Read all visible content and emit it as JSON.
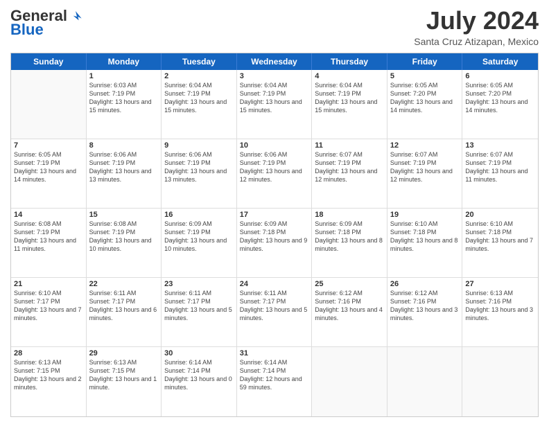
{
  "header": {
    "logo_general": "General",
    "logo_blue": "Blue",
    "month_year": "July 2024",
    "location": "Santa Cruz Atizapan, Mexico"
  },
  "calendar": {
    "days": [
      "Sunday",
      "Monday",
      "Tuesday",
      "Wednesday",
      "Thursday",
      "Friday",
      "Saturday"
    ],
    "rows": [
      [
        {
          "day": "",
          "sunrise": "",
          "sunset": "",
          "daylight": ""
        },
        {
          "day": "1",
          "sunrise": "Sunrise: 6:03 AM",
          "sunset": "Sunset: 7:19 PM",
          "daylight": "Daylight: 13 hours and 15 minutes."
        },
        {
          "day": "2",
          "sunrise": "Sunrise: 6:04 AM",
          "sunset": "Sunset: 7:19 PM",
          "daylight": "Daylight: 13 hours and 15 minutes."
        },
        {
          "day": "3",
          "sunrise": "Sunrise: 6:04 AM",
          "sunset": "Sunset: 7:19 PM",
          "daylight": "Daylight: 13 hours and 15 minutes."
        },
        {
          "day": "4",
          "sunrise": "Sunrise: 6:04 AM",
          "sunset": "Sunset: 7:19 PM",
          "daylight": "Daylight: 13 hours and 15 minutes."
        },
        {
          "day": "5",
          "sunrise": "Sunrise: 6:05 AM",
          "sunset": "Sunset: 7:20 PM",
          "daylight": "Daylight: 13 hours and 14 minutes."
        },
        {
          "day": "6",
          "sunrise": "Sunrise: 6:05 AM",
          "sunset": "Sunset: 7:20 PM",
          "daylight": "Daylight: 13 hours and 14 minutes."
        }
      ],
      [
        {
          "day": "7",
          "sunrise": "Sunrise: 6:05 AM",
          "sunset": "Sunset: 7:19 PM",
          "daylight": "Daylight: 13 hours and 14 minutes."
        },
        {
          "day": "8",
          "sunrise": "Sunrise: 6:06 AM",
          "sunset": "Sunset: 7:19 PM",
          "daylight": "Daylight: 13 hours and 13 minutes."
        },
        {
          "day": "9",
          "sunrise": "Sunrise: 6:06 AM",
          "sunset": "Sunset: 7:19 PM",
          "daylight": "Daylight: 13 hours and 13 minutes."
        },
        {
          "day": "10",
          "sunrise": "Sunrise: 6:06 AM",
          "sunset": "Sunset: 7:19 PM",
          "daylight": "Daylight: 13 hours and 12 minutes."
        },
        {
          "day": "11",
          "sunrise": "Sunrise: 6:07 AM",
          "sunset": "Sunset: 7:19 PM",
          "daylight": "Daylight: 13 hours and 12 minutes."
        },
        {
          "day": "12",
          "sunrise": "Sunrise: 6:07 AM",
          "sunset": "Sunset: 7:19 PM",
          "daylight": "Daylight: 13 hours and 12 minutes."
        },
        {
          "day": "13",
          "sunrise": "Sunrise: 6:07 AM",
          "sunset": "Sunset: 7:19 PM",
          "daylight": "Daylight: 13 hours and 11 minutes."
        }
      ],
      [
        {
          "day": "14",
          "sunrise": "Sunrise: 6:08 AM",
          "sunset": "Sunset: 7:19 PM",
          "daylight": "Daylight: 13 hours and 11 minutes."
        },
        {
          "day": "15",
          "sunrise": "Sunrise: 6:08 AM",
          "sunset": "Sunset: 7:19 PM",
          "daylight": "Daylight: 13 hours and 10 minutes."
        },
        {
          "day": "16",
          "sunrise": "Sunrise: 6:09 AM",
          "sunset": "Sunset: 7:19 PM",
          "daylight": "Daylight: 13 hours and 10 minutes."
        },
        {
          "day": "17",
          "sunrise": "Sunrise: 6:09 AM",
          "sunset": "Sunset: 7:18 PM",
          "daylight": "Daylight: 13 hours and 9 minutes."
        },
        {
          "day": "18",
          "sunrise": "Sunrise: 6:09 AM",
          "sunset": "Sunset: 7:18 PM",
          "daylight": "Daylight: 13 hours and 8 minutes."
        },
        {
          "day": "19",
          "sunrise": "Sunrise: 6:10 AM",
          "sunset": "Sunset: 7:18 PM",
          "daylight": "Daylight: 13 hours and 8 minutes."
        },
        {
          "day": "20",
          "sunrise": "Sunrise: 6:10 AM",
          "sunset": "Sunset: 7:18 PM",
          "daylight": "Daylight: 13 hours and 7 minutes."
        }
      ],
      [
        {
          "day": "21",
          "sunrise": "Sunrise: 6:10 AM",
          "sunset": "Sunset: 7:17 PM",
          "daylight": "Daylight: 13 hours and 7 minutes."
        },
        {
          "day": "22",
          "sunrise": "Sunrise: 6:11 AM",
          "sunset": "Sunset: 7:17 PM",
          "daylight": "Daylight: 13 hours and 6 minutes."
        },
        {
          "day": "23",
          "sunrise": "Sunrise: 6:11 AM",
          "sunset": "Sunset: 7:17 PM",
          "daylight": "Daylight: 13 hours and 5 minutes."
        },
        {
          "day": "24",
          "sunrise": "Sunrise: 6:11 AM",
          "sunset": "Sunset: 7:17 PM",
          "daylight": "Daylight: 13 hours and 5 minutes."
        },
        {
          "day": "25",
          "sunrise": "Sunrise: 6:12 AM",
          "sunset": "Sunset: 7:16 PM",
          "daylight": "Daylight: 13 hours and 4 minutes."
        },
        {
          "day": "26",
          "sunrise": "Sunrise: 6:12 AM",
          "sunset": "Sunset: 7:16 PM",
          "daylight": "Daylight: 13 hours and 3 minutes."
        },
        {
          "day": "27",
          "sunrise": "Sunrise: 6:13 AM",
          "sunset": "Sunset: 7:16 PM",
          "daylight": "Daylight: 13 hours and 3 minutes."
        }
      ],
      [
        {
          "day": "28",
          "sunrise": "Sunrise: 6:13 AM",
          "sunset": "Sunset: 7:15 PM",
          "daylight": "Daylight: 13 hours and 2 minutes."
        },
        {
          "day": "29",
          "sunrise": "Sunrise: 6:13 AM",
          "sunset": "Sunset: 7:15 PM",
          "daylight": "Daylight: 13 hours and 1 minute."
        },
        {
          "day": "30",
          "sunrise": "Sunrise: 6:14 AM",
          "sunset": "Sunset: 7:14 PM",
          "daylight": "Daylight: 13 hours and 0 minutes."
        },
        {
          "day": "31",
          "sunrise": "Sunrise: 6:14 AM",
          "sunset": "Sunset: 7:14 PM",
          "daylight": "Daylight: 12 hours and 59 minutes."
        },
        {
          "day": "",
          "sunrise": "",
          "sunset": "",
          "daylight": ""
        },
        {
          "day": "",
          "sunrise": "",
          "sunset": "",
          "daylight": ""
        },
        {
          "day": "",
          "sunrise": "",
          "sunset": "",
          "daylight": ""
        }
      ]
    ]
  }
}
